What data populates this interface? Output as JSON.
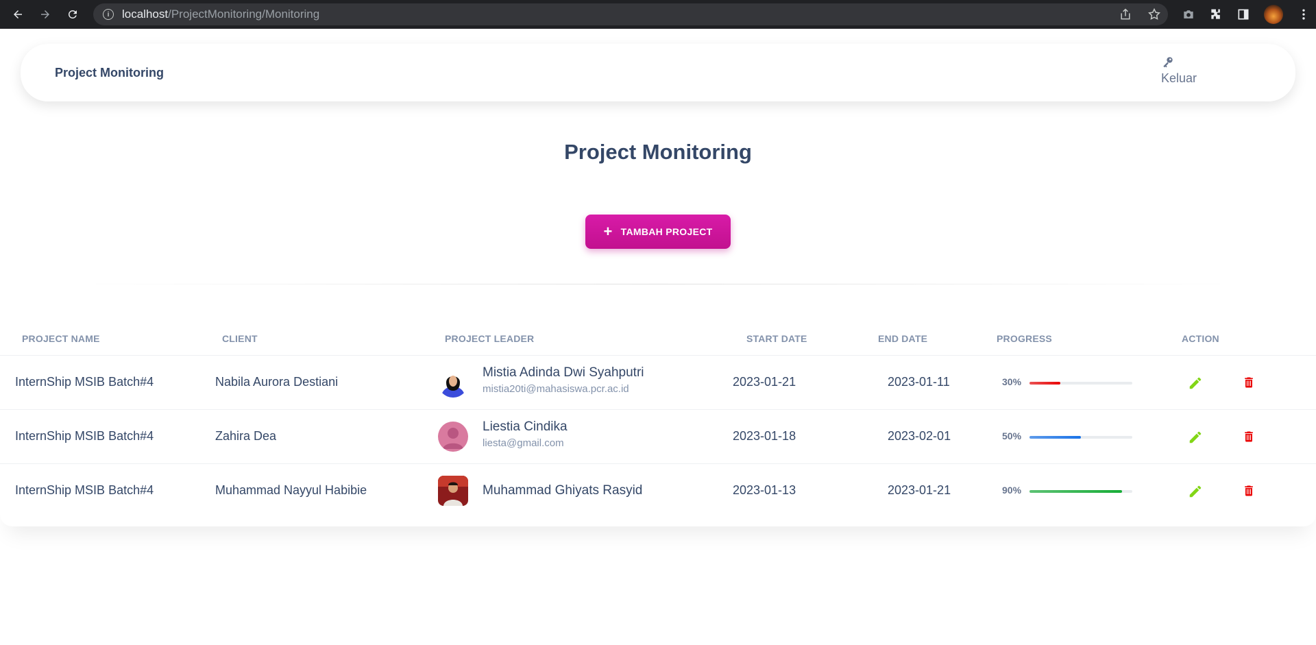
{
  "browser": {
    "url_host": "localhost",
    "url_path": "/ProjectMonitoring/Monitoring"
  },
  "nav": {
    "brand": "Project Monitoring",
    "logout_label": "Keluar"
  },
  "page": {
    "title": "Project Monitoring",
    "add_button_label": "TAMBAH PROJECT"
  },
  "table": {
    "headers": [
      "PROJECT NAME",
      "CLIENT",
      "PROJECT LEADER",
      "START DATE",
      "END DATE",
      "PROGRESS",
      "ACTION"
    ],
    "rows": [
      {
        "project_name": "InternShip MSIB Batch#4",
        "client": "Nabila Aurora Destiani",
        "leader_name": "Mistia Adinda Dwi Syahputri",
        "leader_email": "mistia20ti@mahasiswa.pcr.ac.id",
        "start_date": "2023-01-21",
        "end_date": "2023-01-11",
        "progress_label": "30%",
        "progress": 30,
        "progress_color": "#ea0606"
      },
      {
        "project_name": "InternShip MSIB Batch#4",
        "client": "Zahira Dea",
        "leader_name": "Liestia Cindika",
        "leader_email": "liesta@gmail.com",
        "start_date": "2023-01-18",
        "end_date": "2023-02-01",
        "progress_label": "50%",
        "progress": 50,
        "progress_color": "#1a73e8"
      },
      {
        "project_name": "InternShip MSIB Batch#4",
        "client": "Muhammad Nayyul Habibie",
        "leader_name": "Muhammad Ghiyats Rasyid",
        "leader_email": "",
        "start_date": "2023-01-13",
        "end_date": "2023-01-21",
        "progress_label": "90%",
        "progress": 90,
        "progress_color": "#17ad37"
      }
    ]
  },
  "colors": {
    "accent": "#cb0c9f",
    "edit_icon": "#82d616",
    "delete_icon": "#ea0606",
    "text_dark": "#344767",
    "text_muted": "#8392ab"
  },
  "icons": {
    "nav_logout": "key-icon",
    "add": "plus-icon",
    "edit": "pencil-icon",
    "delete": "trash-icon"
  }
}
